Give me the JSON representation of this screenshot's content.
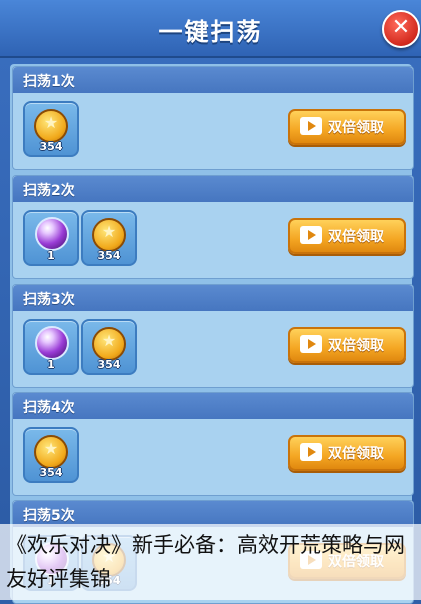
{
  "header": {
    "title": "一键扫荡",
    "close_label": "✕"
  },
  "button_label": "双倍领取",
  "cards": [
    {
      "title": "扫荡1次",
      "items": [
        {
          "type": "coin",
          "qty": "354"
        }
      ]
    },
    {
      "title": "扫荡2次",
      "items": [
        {
          "type": "orb",
          "qty": "1"
        },
        {
          "type": "coin",
          "qty": "354"
        }
      ]
    },
    {
      "title": "扫荡3次",
      "items": [
        {
          "type": "orb",
          "qty": "1"
        },
        {
          "type": "coin",
          "qty": "354"
        }
      ]
    },
    {
      "title": "扫荡4次",
      "items": [
        {
          "type": "coin",
          "qty": "354"
        }
      ]
    },
    {
      "title": "扫荡5次",
      "items": [
        {
          "type": "orb",
          "qty": "1"
        },
        {
          "type": "coin",
          "qty": "354"
        }
      ]
    }
  ],
  "caption": "《欢乐对决》新手必备：高效开荒策略与网友好评集锦",
  "colors": {
    "header": "#3a6fc0",
    "button": "#f4a623",
    "close": "#d22a1e"
  }
}
